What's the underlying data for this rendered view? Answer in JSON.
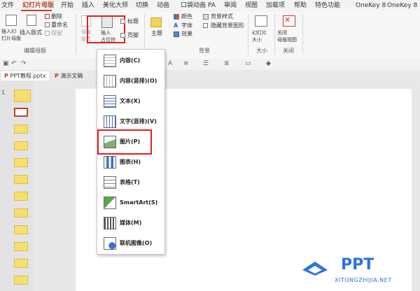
{
  "tabs": [
    "文件",
    "幻灯片母版",
    "开始",
    "插入",
    "美化大师",
    "切换",
    "动画",
    "口袋动画 PA",
    "审阅",
    "视图",
    "加载项",
    "帮助",
    "特色功能",
    "OneKey 8",
    "OneKey 8 Plus"
  ],
  "active_tab": "幻灯片母版",
  "ribbon": {
    "insert_master": "插入幻\n灯片母版",
    "insert_layout": "插入版式",
    "delete": "删除",
    "rename": "重命名",
    "preserve": "保留",
    "master_layout": "母版\n版式",
    "insert_placeholder": "插入\n占位符",
    "title_check": "标题",
    "footer_check": "页脚",
    "theme": "主题",
    "colors": "颜色",
    "fonts": "字体",
    "effects": "效果",
    "bg_styles": "背景样式",
    "hide_bg": "隐藏背景图形",
    "slide_size": "幻灯片\n大小",
    "close_master": "关闭\n母版视图",
    "group_edit_master": "编辑母版",
    "group_background": "背景",
    "group_size": "大小",
    "group_close": "关闭"
  },
  "doc_tabs": [
    "PPT教程.pptx",
    "演示文稿"
  ],
  "thumb_number": "1",
  "menu_items": [
    {
      "label": "内容(C)",
      "icon": "content-icon"
    },
    {
      "label": "内容(竖排)(O)",
      "icon": "content-vertical-icon"
    },
    {
      "label": "文本(X)",
      "icon": "text-icon"
    },
    {
      "label": "文字(竖排)(V)",
      "icon": "text-vertical-icon"
    },
    {
      "label": "图片(P)",
      "icon": "picture-icon"
    },
    {
      "label": "图表(H)",
      "icon": "chart-icon"
    },
    {
      "label": "表格(T)",
      "icon": "table-icon"
    },
    {
      "label": "SmartArt(S)",
      "icon": "smartart-icon"
    },
    {
      "label": "媒体(M)",
      "icon": "media-icon"
    },
    {
      "label": "联机图像(O)",
      "icon": "online-image-icon"
    }
  ],
  "watermark": {
    "brand": "PPT",
    "url": "XITONGZHIJIA.NET"
  },
  "colors": {
    "accent": "#b7472a",
    "highlight": "#e02020",
    "thumb": "#f7df6e"
  }
}
